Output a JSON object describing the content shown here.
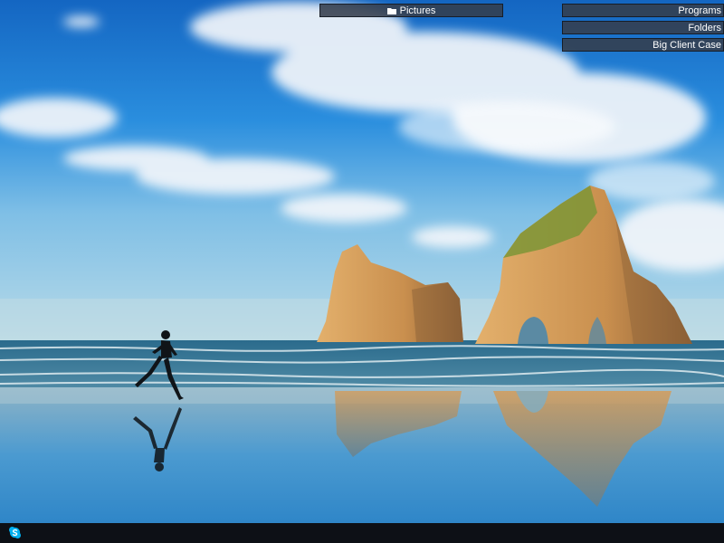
{
  "desktop": {
    "wallpaper": "beach-runner-rock-arches",
    "bars": {
      "pictures": {
        "label": "Pictures",
        "icon": "folder-icon"
      },
      "programs": {
        "label": "Programs"
      },
      "folders": {
        "label": "Folders"
      },
      "big_client_case": {
        "label": "Big Client Case"
      }
    }
  },
  "taskbar": {
    "pinned": [
      {
        "name": "skype",
        "icon": "skype-icon"
      }
    ]
  },
  "colors": {
    "bar_bg": "#343e4c",
    "taskbar_bg": "#0d1016",
    "skype_blue": "#00aff0"
  }
}
